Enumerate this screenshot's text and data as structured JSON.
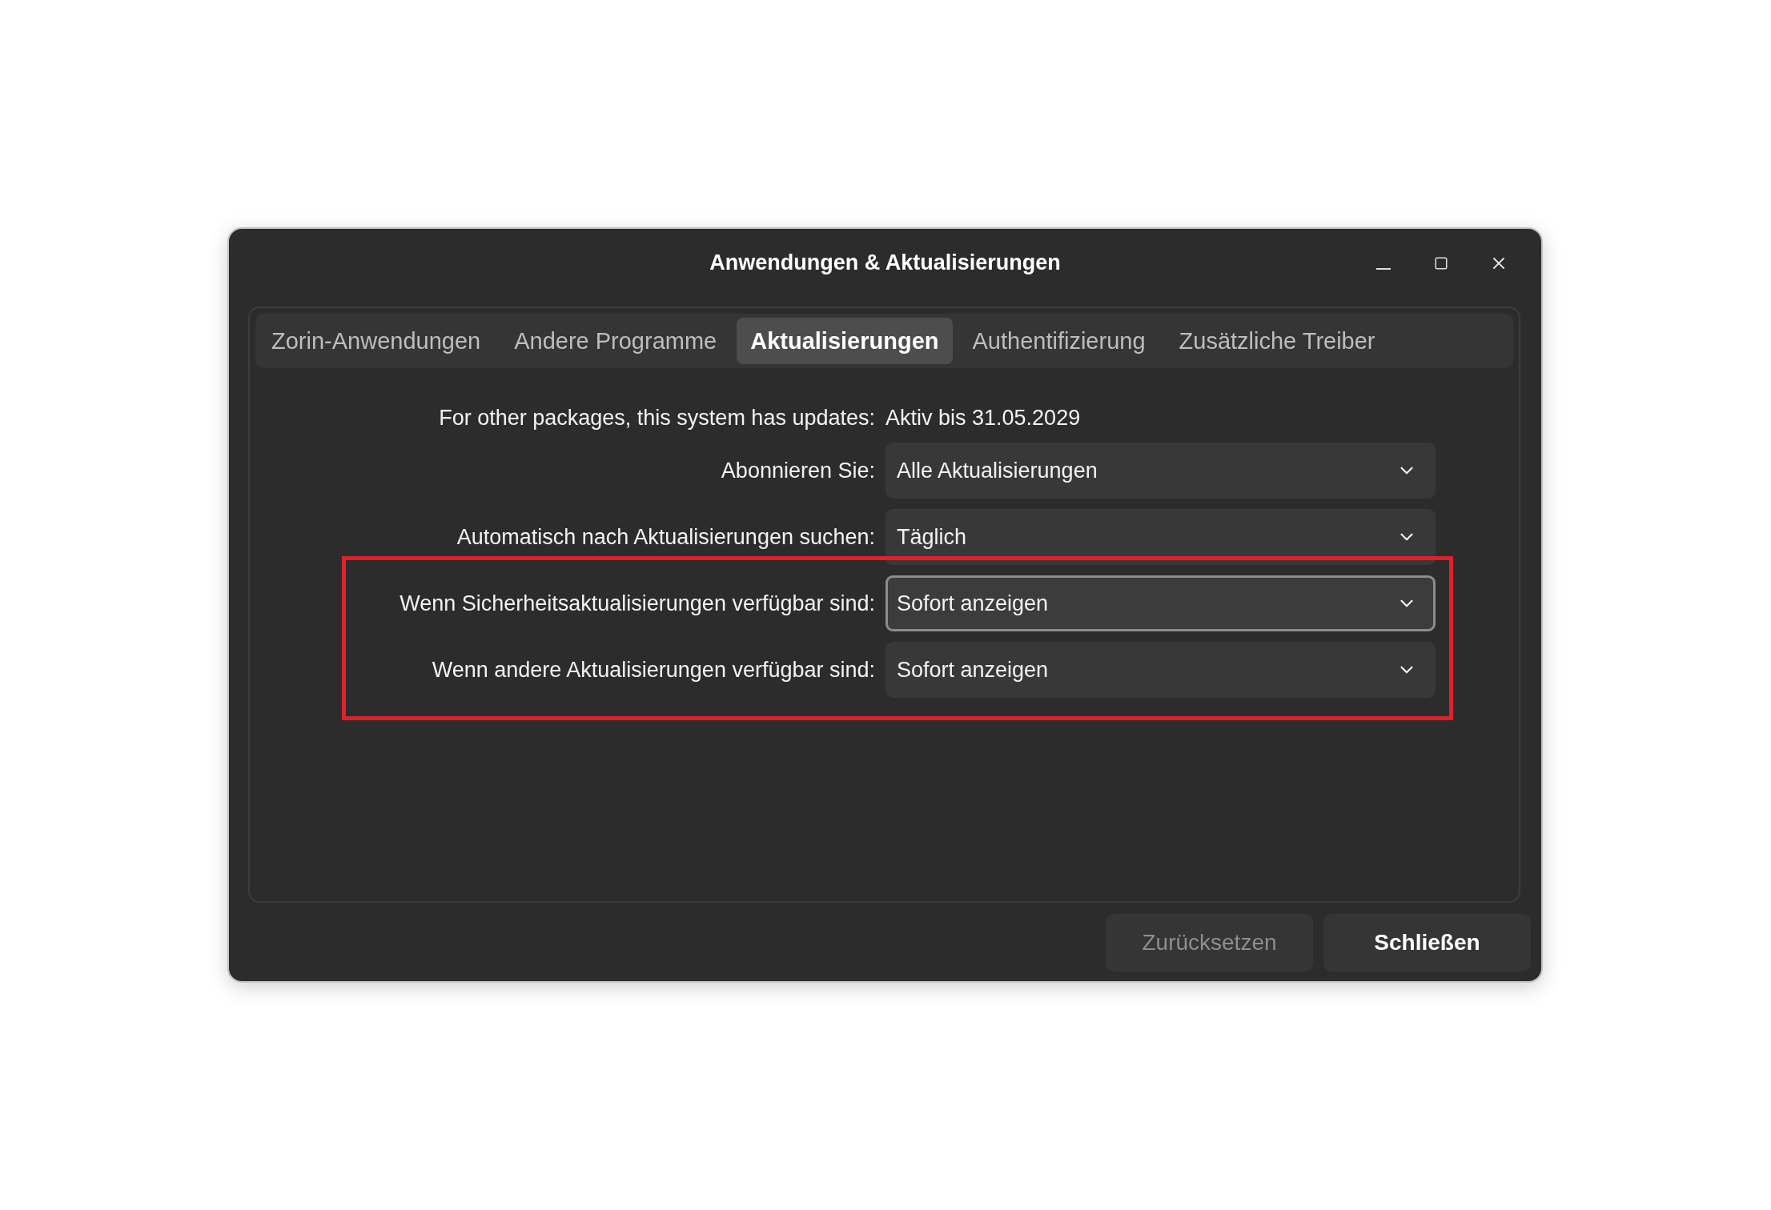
{
  "window": {
    "title": "Anwendungen & Aktualisierungen"
  },
  "tabs": [
    {
      "label": "Zorin-Anwendungen",
      "selected": false
    },
    {
      "label": "Andere Programme",
      "selected": false
    },
    {
      "label": "Aktualisierungen",
      "selected": true
    },
    {
      "label": "Authentifizierung",
      "selected": false
    },
    {
      "label": "Zusätzliche Treiber",
      "selected": false
    }
  ],
  "settings": [
    {
      "kind": "info",
      "label": "For other packages, this system has updates:",
      "value": "Aktiv bis 31.05.2029"
    },
    {
      "kind": "dropdown",
      "label": "Abonnieren Sie:",
      "value": "Alle Aktualisierungen",
      "focused": false
    },
    {
      "kind": "dropdown",
      "label": "Automatisch nach Aktualisierungen suchen:",
      "value": "Täglich",
      "focused": false
    },
    {
      "kind": "dropdown",
      "label": "Wenn Sicherheitsaktualisierungen verfügbar sind:",
      "value": "Sofort anzeigen",
      "focused": true
    },
    {
      "kind": "dropdown",
      "label": "Wenn andere Aktualisierungen verfügbar sind:",
      "value": "Sofort anzeigen",
      "focused": false
    }
  ],
  "buttons": [
    {
      "label": "Zurücksetzen",
      "disabled": true
    },
    {
      "label": "Schließen",
      "disabled": false
    }
  ]
}
